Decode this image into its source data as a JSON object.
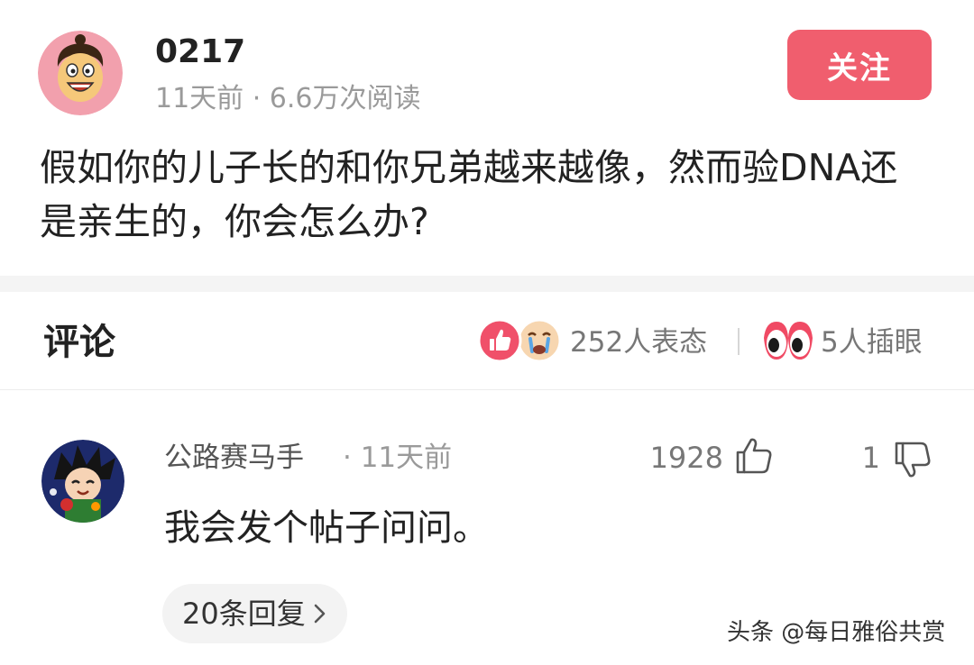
{
  "post": {
    "author_name": "0217",
    "meta": "11天前 · 6.6万次阅读",
    "follow_label": "关注",
    "question": "假如你的儿子长的和你兄弟越来越像，然而验DNA还是亲生的，你会怎么办?"
  },
  "comments_header": {
    "title": "评论",
    "reactions_count": "252人表态",
    "eyes_count": "5人插眼"
  },
  "comments": [
    {
      "author": "公路赛马手",
      "time": "· 11天前",
      "likes": "1928",
      "dislikes": "1",
      "text": "我会发个帖子问问。",
      "replies_label": "20条回复"
    }
  ],
  "watermark": "头条 @每日雅俗共赏",
  "colors": {
    "follow_button": "#f05e6e",
    "divider": "#f4f4f4",
    "muted_text": "#9a9a9a"
  },
  "icons": [
    "author-avatar",
    "thumbs-up-reaction-icon",
    "crying-face-reaction-icon",
    "eyes-icon",
    "like-icon",
    "dislike-icon",
    "chevron-right-icon"
  ]
}
